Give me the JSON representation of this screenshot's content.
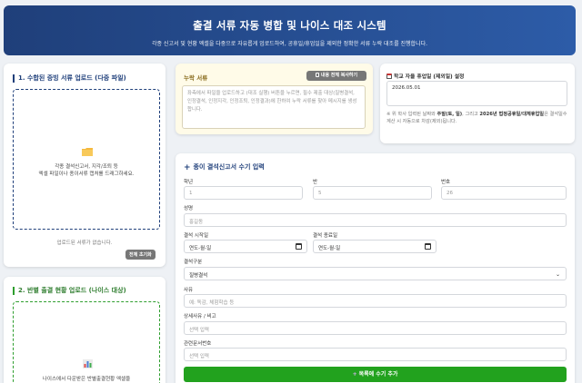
{
  "header": {
    "title": "출결 서류 자동 병합 및 나이스 대조 시스템",
    "subtitle": "각종 신고서 및 현황 엑셀을 다중으로 자유롭게 업로드하여, 공휴일/휴업일을 제외한 정확한 서류 누락 대조를 진행합니다."
  },
  "upload1": {
    "title": "1. 수합된 증빙 서류 업로드 (다중 파일)",
    "drop_line1": "각종 결석신고서, 지각/조퇴 등",
    "drop_line2": "엑셀 파일이나 종이서류 캡처를 드래그하세요.",
    "status": "업로드된 서류가 없습니다.",
    "reset_label": "전체 초기화"
  },
  "upload2": {
    "title": "2. 반별 출결 현황 업로드 (나이스 대상)",
    "drop_line1": "나이스에서 다운받은 반별출결현황 엑셀을"
  },
  "missing": {
    "title": "누락 서류",
    "copy_label": "내용 전체 복사하기",
    "placeholder": "좌측에서 파일을 업로드하고 (대조 실행) 버튼을 누르면, 필수 제출 대상(질병결석, 인정결석, 인정지각, 인정조퇴, 인정결과)에 한하여 누락 서류를 찾아 메시지를 생성합니다."
  },
  "holiday": {
    "title": "학교 자율 휴업일 (제외일) 설정",
    "value": "2026.05.01",
    "note_prefix": "※ 위 학사 입력된 날짜와 ",
    "note_b1": "주말(토, 일)",
    "note_mid": ", 그리고 ",
    "note_b2": "2026년 법정공휴일/대체휴업일",
    "note_suffix": "은 결석일수 계산 시 자동으로 차감(제외)됩니다."
  },
  "manual": {
    "title": "종이 결석신고서 수기 입력",
    "grade_label": "학년",
    "grade_ph": "1",
    "class_label": "반",
    "class_ph": "5",
    "num_label": "번호",
    "num_ph": "26",
    "name_label": "성명",
    "name_ph": "홍길동",
    "start_label": "결석 시작일",
    "start_ph": "연도-월-일",
    "end_label": "결석 종료일",
    "end_ph": "연도-월-일",
    "type_label": "결석구분",
    "type_value": "질병결석",
    "reason_label": "사유",
    "reason_ph": "예: 독감, 체험학습 등",
    "detail_label": "상세사유 / 비고",
    "detail_ph": "선택 입력",
    "doc_label": "관련문서번호",
    "doc_ph": "선택 입력",
    "add_label": "목록에 수기 추가"
  },
  "colors": {
    "header_start": "#1f3f7a",
    "header_end": "#2d5ca8",
    "upload1_border": "#1f3f7a",
    "upload2_border": "#2e9e2e",
    "missing_bg": "#fffbe8",
    "add_button": "#22a21e"
  }
}
